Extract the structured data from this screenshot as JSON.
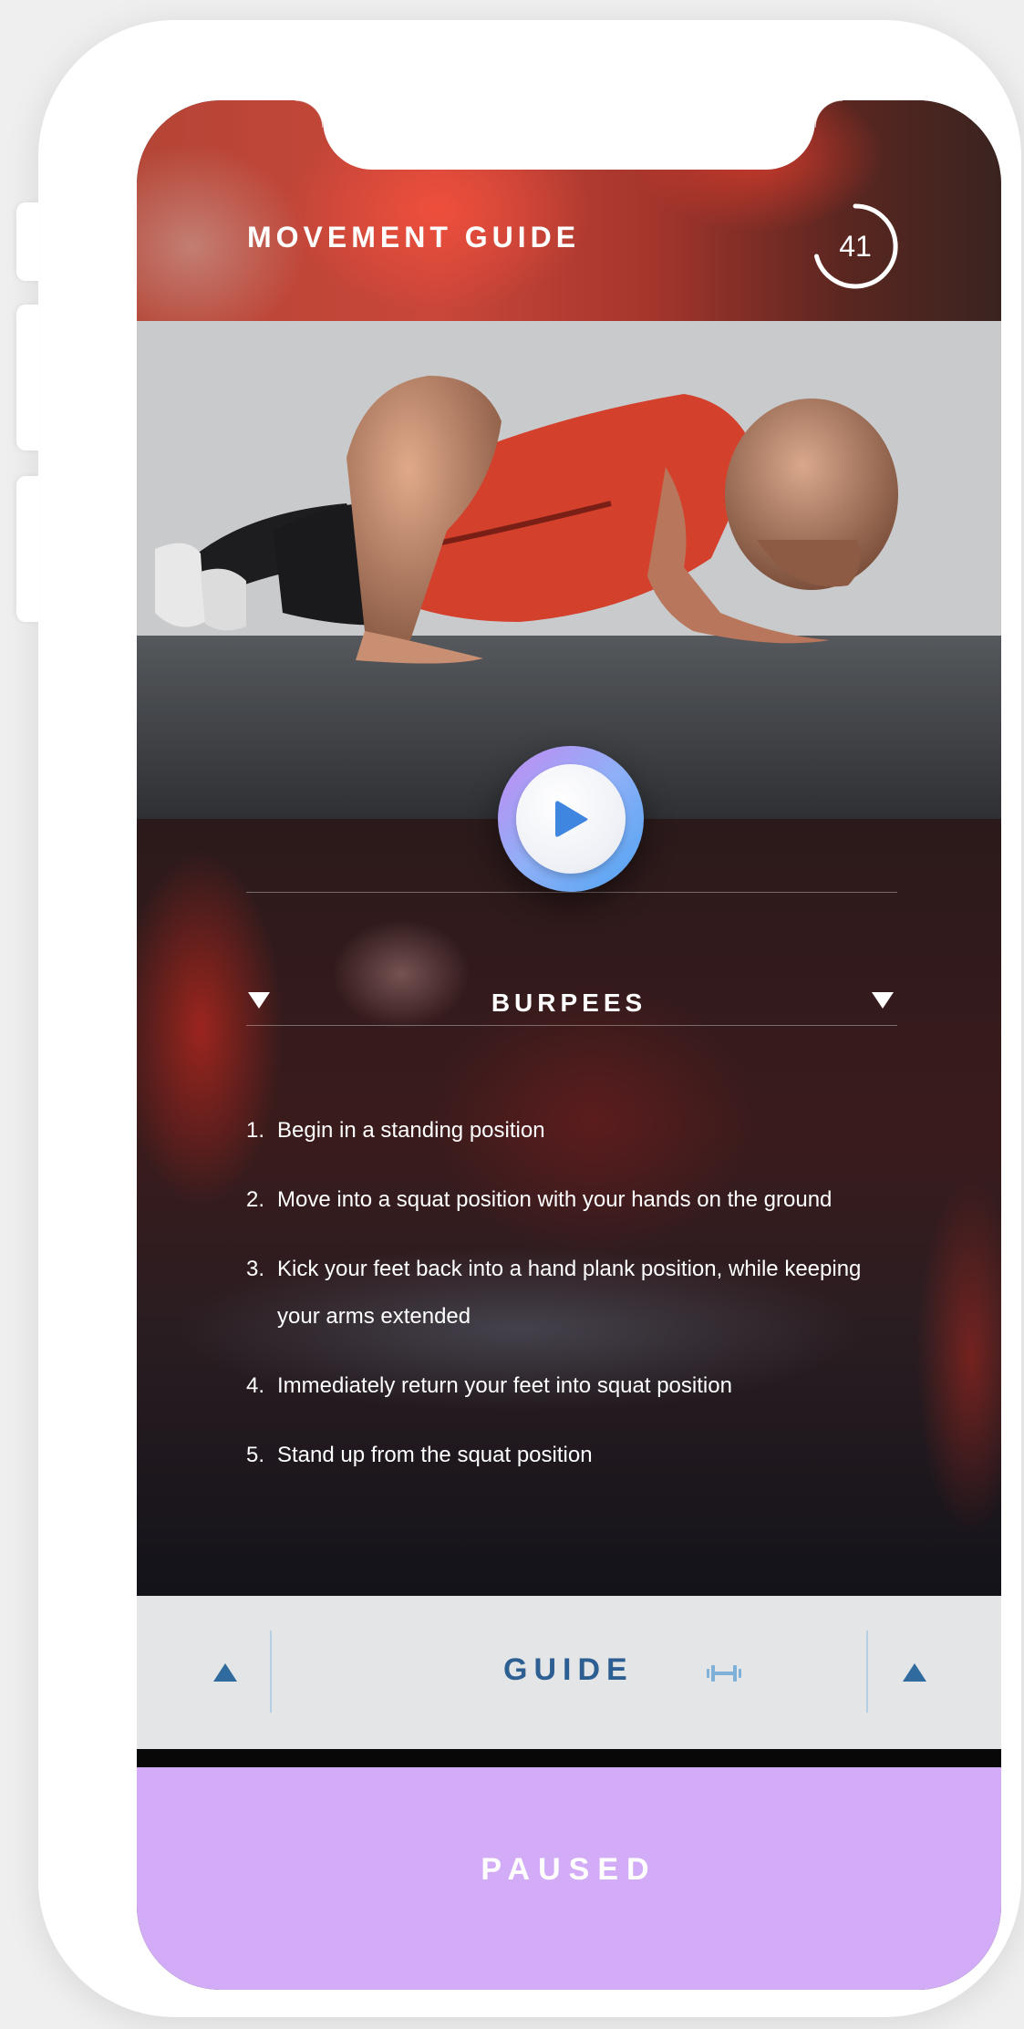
{
  "header": {
    "title": "MOVEMENT GUIDE",
    "timer_value": "41"
  },
  "exercise": {
    "name": "BURPEES",
    "steps": [
      {
        "num": "1.",
        "text": "Begin in a standing position"
      },
      {
        "num": "2.",
        "text": "Move into a squat position with your hands on the ground"
      },
      {
        "num": "3.",
        "text": "Kick your feet back into a hand plank position, while keeping your arms extended"
      },
      {
        "num": "4.",
        "text": "Immediately return your feet into squat position"
      },
      {
        "num": "5.",
        "text": "Stand up from the squat position"
      }
    ]
  },
  "nav": {
    "label": "GUIDE"
  },
  "status": {
    "label": "PAUSED"
  },
  "colors": {
    "accent_blue": "#2d5f92",
    "paused_bg": "#d3acf8",
    "play_gradient_start": "#c38af2",
    "play_gradient_end": "#4ea3f2"
  }
}
